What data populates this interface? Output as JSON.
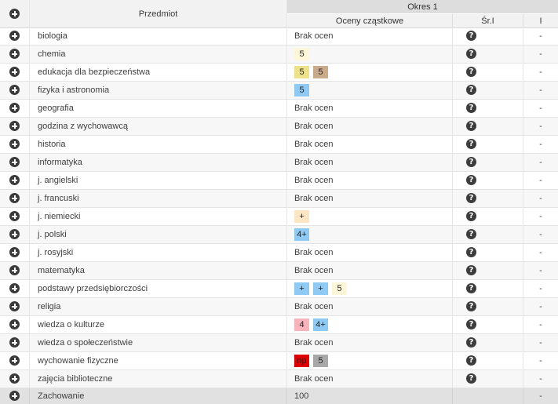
{
  "header": {
    "subject_label": "Przedmiot",
    "period_label": "Okres 1",
    "partial_label": "Oceny cząstkowe",
    "avg_label": "Śr.I",
    "final_label": "I"
  },
  "rows": [
    {
      "subject": "biologia",
      "no_grades": "Brak ocen",
      "grades": [],
      "final": "-"
    },
    {
      "subject": "chemia",
      "grades": [
        {
          "value": "5",
          "color": "#fdf6d8"
        }
      ],
      "final": "-"
    },
    {
      "subject": "edukacja dla bezpieczeństwa",
      "grades": [
        {
          "value": "5",
          "color": "#ede18a"
        },
        {
          "value": "5",
          "color": "#c9aa8a"
        }
      ],
      "final": "-"
    },
    {
      "subject": "fizyka i astronomia",
      "grades": [
        {
          "value": "5",
          "color": "#8ecaf3"
        }
      ],
      "final": "-"
    },
    {
      "subject": "geografia",
      "no_grades": "Brak ocen",
      "grades": [],
      "final": "-"
    },
    {
      "subject": "godzina z wychowawcą",
      "no_grades": "Brak ocen",
      "grades": [],
      "final": "-"
    },
    {
      "subject": "historia",
      "no_grades": "Brak ocen",
      "grades": [],
      "final": "-"
    },
    {
      "subject": "informatyka",
      "no_grades": "Brak ocen",
      "grades": [],
      "final": "-"
    },
    {
      "subject": "j. angielski",
      "no_grades": "Brak ocen",
      "grades": [],
      "final": "-"
    },
    {
      "subject": "j. francuski",
      "no_grades": "Brak ocen",
      "grades": [],
      "final": "-"
    },
    {
      "subject": "j. niemiecki",
      "grades": [
        {
          "value": "+",
          "color": "#fde6c4"
        }
      ],
      "final": "-"
    },
    {
      "subject": "j. polski",
      "grades": [
        {
          "value": "4+",
          "color": "#8ecaf3"
        }
      ],
      "final": "-"
    },
    {
      "subject": "j. rosyjski",
      "no_grades": "Brak ocen",
      "grades": [],
      "final": "-"
    },
    {
      "subject": "matematyka",
      "no_grades": "Brak ocen",
      "grades": [],
      "final": "-"
    },
    {
      "subject": "podstawy przedsiębiorczości",
      "grades": [
        {
          "value": "+",
          "color": "#8ecaf3"
        },
        {
          "value": "+",
          "color": "#8ecaf3"
        },
        {
          "value": "5",
          "color": "#fdf6d8"
        }
      ],
      "final": "-"
    },
    {
      "subject": "religia",
      "no_grades": "Brak ocen",
      "grades": [],
      "final": "-"
    },
    {
      "subject": "wiedza o kulturze",
      "grades": [
        {
          "value": "4",
          "color": "#f8b3bb"
        },
        {
          "value": "4+",
          "color": "#8ecaf3"
        }
      ],
      "final": "-"
    },
    {
      "subject": "wiedza o społeczeństwie",
      "no_grades": "Brak ocen",
      "grades": [],
      "final": "-"
    },
    {
      "subject": "wychowanie fizyczne",
      "grades": [
        {
          "value": "np",
          "color": "#e00000"
        },
        {
          "value": "5",
          "color": "#a8a8a8"
        }
      ],
      "final": "-"
    },
    {
      "subject": "zajęcia biblioteczne",
      "no_grades": "Brak ocen",
      "grades": [],
      "final": "-"
    }
  ],
  "conduct": {
    "subject": "Zachowanie",
    "value": "100",
    "final": "-"
  },
  "icons": {
    "expand": "plus-circle-icon",
    "average": "question-circle-icon"
  },
  "avg_glyph": "?"
}
